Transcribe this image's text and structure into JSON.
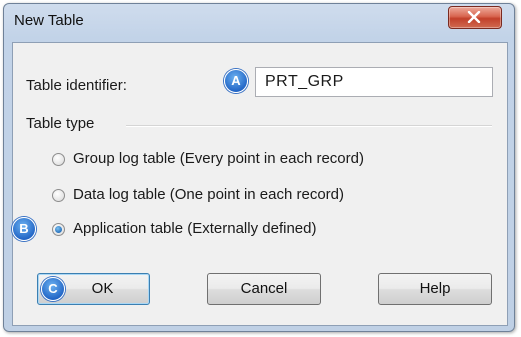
{
  "window": {
    "title": "New Table",
    "close_glyph": "✕"
  },
  "identifier": {
    "label": "Table identifier:",
    "value": "PRT_GRP"
  },
  "table_type": {
    "title": "Table type",
    "options": [
      {
        "label": "Group log table (Every point in each record)",
        "selected": false
      },
      {
        "label": "Data log table (One point in each record)",
        "selected": false
      },
      {
        "label": "Application table (Externally defined)",
        "selected": true
      }
    ]
  },
  "buttons": {
    "ok": "OK",
    "cancel": "Cancel",
    "help": "Help"
  },
  "callouts": {
    "a": "A",
    "b": "B",
    "c": "C"
  },
  "colors": {
    "callout": "#2a6fd0",
    "close_button": "#c9452f",
    "dialog_bg": "#f0f0f0"
  },
  "icons": {
    "close": "close-x-icon",
    "callout": "callout-badge-icon"
  }
}
